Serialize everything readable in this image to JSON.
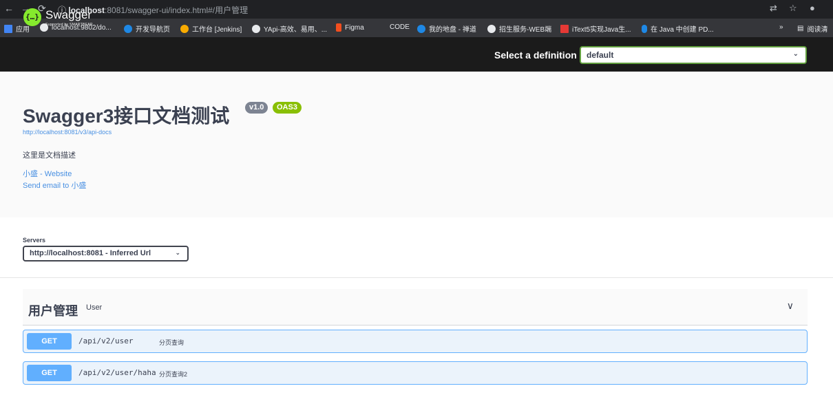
{
  "browser": {
    "url_host": "localhost",
    "url_rest": ":8081/swagger-ui/index.html#/用户管理",
    "bookmarks": [
      {
        "label": "应用",
        "color": "#4285f4"
      },
      {
        "label": "localhost:9802/do...",
        "color": "#e8eaed"
      },
      {
        "label": "开发导航页",
        "color": "#1e88e5"
      },
      {
        "label": "工作台 [Jenkins]",
        "color": "#f9ab00"
      },
      {
        "label": "YApi-高效、易用、...",
        "color": "#e8eaed"
      },
      {
        "label": "Figma",
        "color": "#f24e1e"
      },
      {
        "label": "CODE",
        "color": "#35363a"
      },
      {
        "label": "我的地盘 - 禅道",
        "color": "#1e88e5"
      },
      {
        "label": "招生服务-WEB端",
        "color": "#e8eaed"
      },
      {
        "label": "iText5实现Java生...",
        "color": "#e53935"
      },
      {
        "label": "在 Java 中创建 PD...",
        "color": "#1e88e5"
      }
    ],
    "more": "»",
    "reading_list": "阅读清"
  },
  "topbar": {
    "logo_text": "Swagger",
    "logo_sub": "Supported by SMARTBEAR",
    "definition_label": "Select a definition",
    "definition_value": "default"
  },
  "info": {
    "title": "Swagger3接口文档测试",
    "version": "v1.0",
    "oas": "OAS3",
    "api_url": "http://localhost:8081/v3/api-docs",
    "description": "这里是文档描述",
    "website_link": "小盛 - Website",
    "email_link": "Send email to 小盛"
  },
  "servers": {
    "label": "Servers",
    "selected": "http://localhost:8081 - Inferred Url"
  },
  "tag": {
    "name": "用户管理",
    "description": "User"
  },
  "operations": [
    {
      "method": "GET",
      "path": "/api/v2/user",
      "summary": "分页查询",
      "color": "#61affe"
    },
    {
      "method": "GET",
      "path": "/api/v2/user/haha",
      "summary": "分页查询2",
      "color": "#61affe"
    }
  ]
}
